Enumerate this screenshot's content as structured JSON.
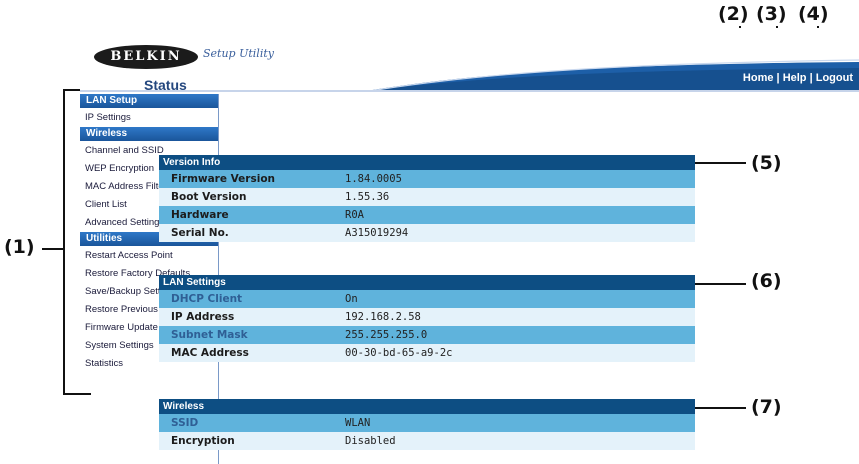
{
  "callouts": {
    "c1": "(1)",
    "c2": "(2)",
    "c3": "(3)",
    "c4": "(4)",
    "c5": "(5)",
    "c6": "(6)",
    "c7": "(7)"
  },
  "header": {
    "logo": "BELKIN",
    "tagline": "Setup Utility",
    "links": {
      "home": "Home",
      "help": "Help",
      "logout": "Logout",
      "sep": "|"
    }
  },
  "sidebar": {
    "sections": [
      {
        "title": "LAN Setup",
        "items": [
          "IP Settings"
        ]
      },
      {
        "title": "Wireless",
        "items": [
          "Channel and SSID",
          "WEP Encryption",
          "MAC Address Filtering",
          "Client List",
          "Advanced Settings"
        ]
      },
      {
        "title": "Utilities",
        "items": [
          "Restart Access Point",
          "Restore Factory Defaults",
          "Save/Backup Settings",
          "Restore Previous Settings",
          "Firmware Update",
          "System Settings",
          "Statistics"
        ]
      }
    ]
  },
  "main": {
    "title": "Status",
    "panels": [
      {
        "title": "Version Info",
        "rows": [
          {
            "label": "Firmware Version",
            "value": "1.84.0005"
          },
          {
            "label": "Boot Version",
            "value": "1.55.36"
          },
          {
            "label": "Hardware",
            "value": "R0A"
          },
          {
            "label": "Serial No.",
            "value": "A315019294"
          }
        ]
      },
      {
        "title": "LAN Settings",
        "rows": [
          {
            "label": "DHCP Client",
            "value": "On"
          },
          {
            "label": "IP Address",
            "value": "192.168.2.58"
          },
          {
            "label": "Subnet Mask",
            "value": "255.255.255.0"
          },
          {
            "label": "MAC Address",
            "value": "00-30-bd-65-a9-2c"
          }
        ]
      },
      {
        "title": "Wireless",
        "rows": [
          {
            "label": "SSID",
            "value": "WLAN"
          },
          {
            "label": "Encryption",
            "value": "Disabled"
          }
        ]
      }
    ]
  },
  "colors": {
    "accent": "#1a559a",
    "row_dark": "#5fb3dc",
    "row_light": "#e4f2fa",
    "panel_title": "#0d4e83"
  }
}
